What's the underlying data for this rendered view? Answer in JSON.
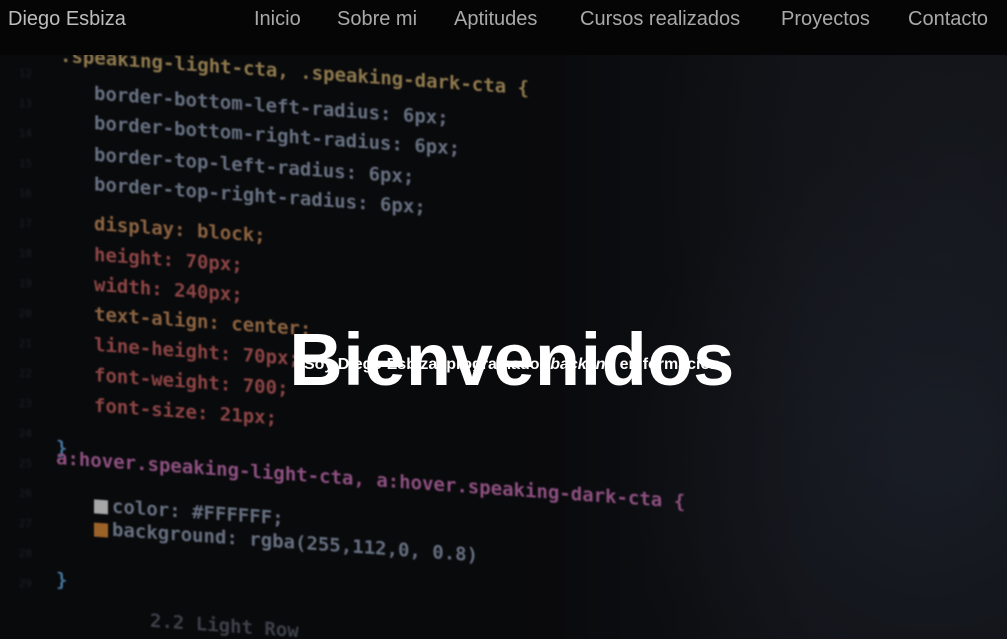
{
  "nav": {
    "brand": "Diego Esbiza",
    "links": [
      "Inicio",
      "Sobre mi",
      "Aptitudes",
      "Cursos realizados",
      "Proyectos",
      "Contacto"
    ]
  },
  "hero": {
    "title": "Bienvenidos",
    "subtitle_before": "Soy Diego Esbiza, programador ",
    "subtitle_emphasis": "backend",
    "subtitle_after": " en formación"
  },
  "background_code": [
    ".speaking-light-cta, .speaking-dark-cta {",
    "border-bottom-left-radius: 6px;",
    "border-bottom-right-radius: 6px;",
    "border-top-left-radius: 6px;",
    "border-top-right-radius: 6px;",
    "display: block;",
    "height: 70px;",
    "width: 240px;",
    "text-align: center;",
    "line-height: 70px;",
    "font-weight: 700;",
    "font-size: 21px;",
    "}",
    "a:hover.speaking-light-cta, a:hover.speaking-dark-cta {",
    "color: #FFFFFF;",
    "background: rgba(255,112,0, 0.8)",
    "}",
    "2.2 Light Row"
  ],
  "colors": {
    "navbar_bg": "#050505",
    "nav_text": "#a9a9a9",
    "brand_text": "#bdbdbd",
    "hero_text": "#ffffff"
  }
}
